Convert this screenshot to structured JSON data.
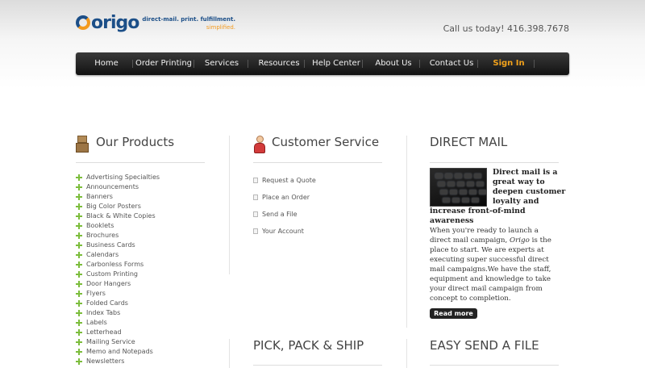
{
  "header": {
    "logo_text": "origo",
    "tagline": "direct-mail. print. fulfillment.",
    "tagline_sub": "simplified.",
    "phone": "Call us today! 416.398.7678"
  },
  "nav": {
    "items": [
      "Home",
      "Order Printing",
      "Services",
      "Resources",
      "Help Center",
      "About Us",
      "Contact Us"
    ],
    "signin": "Sign In"
  },
  "products": {
    "heading": "Our Products",
    "items": [
      "Advertising Specialties",
      "Announcements",
      "Banners",
      "Big Color Posters",
      "Black & White Copies",
      "Booklets",
      "Brochures",
      "Business Cards",
      "Calendars",
      "Carbonless Forms",
      "Custom Printing",
      "Door Hangers",
      "Flyers",
      "Folded Cards",
      "Index Tabs",
      "Labels",
      "Letterhead",
      "Mailing Service",
      "Memo and Notepads",
      "Newsletters"
    ]
  },
  "customer_service": {
    "heading": "Customer Service",
    "items": [
      "Request a Quote",
      "Place an Order",
      "Send a File",
      "Your Account"
    ]
  },
  "direct_mail": {
    "heading": "DIRECT MAIL",
    "lead": "Direct mail is a great way to deepen customer loyalty and increase front-of-mind awareness",
    "body_before": "When you're ready to launch a direct mail campaign, ",
    "body_em": "Origo",
    "body_after": " is the place to start. We are experts at executing super successful direct mail campaigns.We have the staff, equipment and knowledge to take your direct mail campaign from concept to completion.",
    "read_more": "Read more"
  },
  "pick_pack": {
    "heading": "PICK, PACK & SHIP"
  },
  "send_file": {
    "heading": "EASY SEND A FILE"
  }
}
